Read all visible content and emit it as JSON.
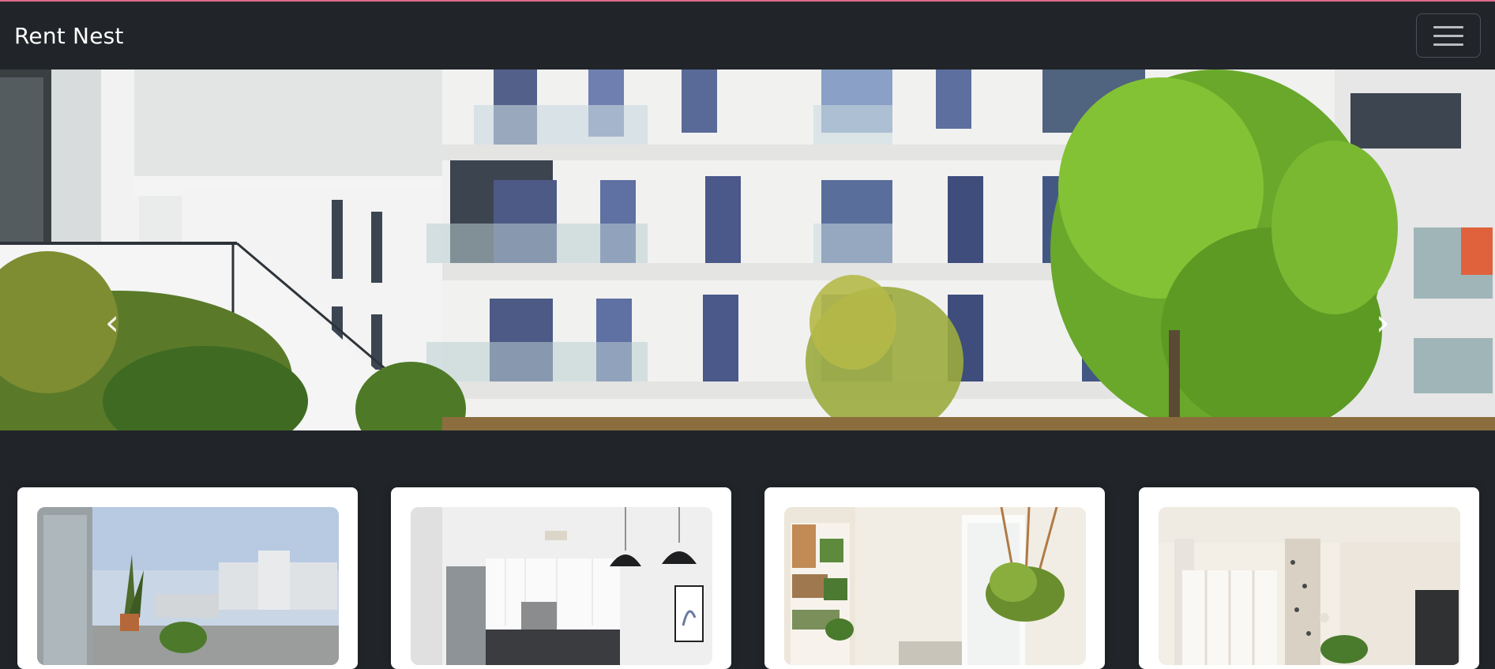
{
  "navbar": {
    "brand": "Rent Nest",
    "toggler_icon": "hamburger-menu-icon"
  },
  "hero": {
    "image": "modern-apartment-building-with-trees",
    "prev_icon": "chevron-left-icon",
    "next_icon": "chevron-right-icon",
    "prev_glyph": "‹",
    "next_glyph": "›"
  },
  "cards": [
    {
      "image": "balcony-with-plants-city-view"
    },
    {
      "image": "white-kitchen-pendant-lights"
    },
    {
      "image": "living-room-bookshelf-hanging-plant"
    },
    {
      "image": "bright-room-curtains-window"
    }
  ],
  "colors": {
    "navbar_bg": "#212529",
    "page_bg": "#212529",
    "accent_line": "#e06a8a",
    "card_bg": "#ffffff"
  }
}
